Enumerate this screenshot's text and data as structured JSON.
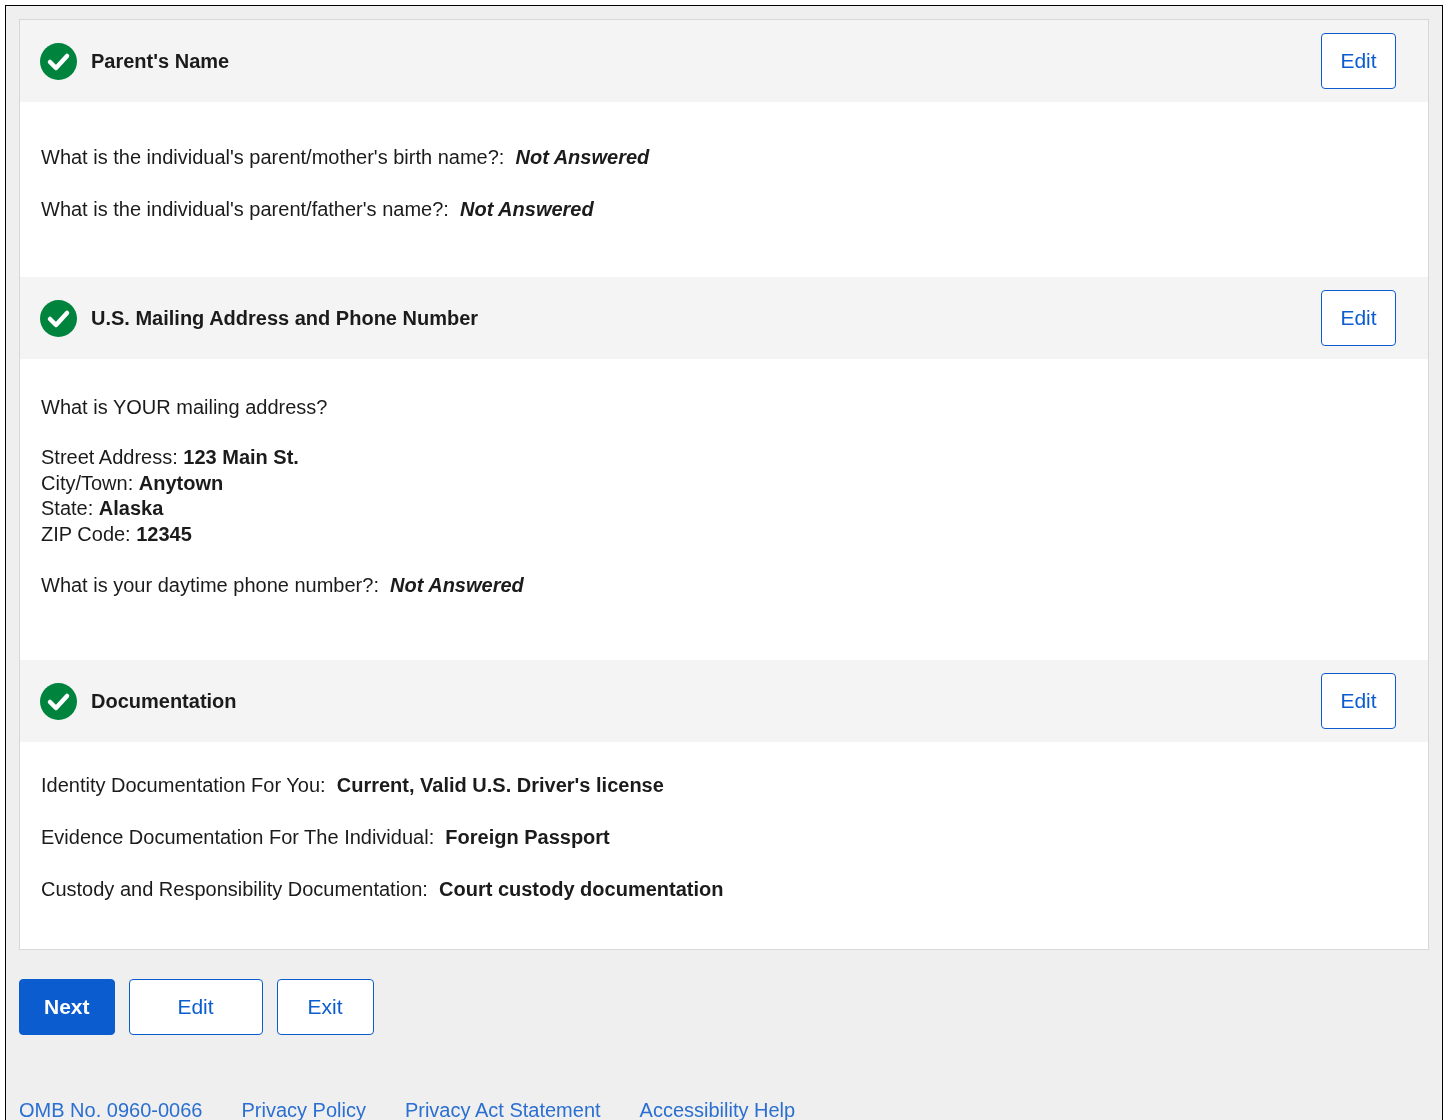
{
  "sections": [
    {
      "title": "Parent's Name",
      "complete": true,
      "edit_label": "Edit",
      "blocks": [
        {
          "kind": "qa",
          "question": "What is the individual's parent/mother's birth name?:",
          "answer": "Not Answered",
          "answered": false
        },
        {
          "kind": "qa",
          "question": "What is the individual's parent/father's name?:",
          "answer": "Not Answered",
          "answered": false
        }
      ]
    },
    {
      "title": "U.S. Mailing Address and Phone Number",
      "complete": true,
      "edit_label": "Edit",
      "blocks": [
        {
          "kind": "heading",
          "text": "What is YOUR mailing address?"
        },
        {
          "kind": "fields",
          "items": [
            {
              "label": "Street Address:",
              "value": "123 Main St."
            },
            {
              "label": "City/Town:",
              "value": "Anytown"
            },
            {
              "label": "State:",
              "value": "Alaska"
            },
            {
              "label": "ZIP Code:",
              "value": "12345"
            }
          ]
        },
        {
          "kind": "qa",
          "question": "What is your daytime phone number?:",
          "answer": "Not Answered",
          "answered": false
        }
      ]
    },
    {
      "title": "Documentation",
      "complete": true,
      "edit_label": "Edit",
      "blocks": [
        {
          "kind": "qa",
          "question": "Identity Documentation For You:",
          "answer": "Current, Valid U.S. Driver's license",
          "answered": true
        },
        {
          "kind": "qa",
          "question": "Evidence Documentation For The Individual:",
          "answer": "Foreign Passport",
          "answered": true
        },
        {
          "kind": "qa",
          "question": "Custody and Responsibility Documentation:",
          "answer": "Court custody documentation",
          "answered": true
        }
      ]
    }
  ],
  "buttons": [
    {
      "label": "Next",
      "primary": true
    },
    {
      "label": "Edit",
      "primary": false
    },
    {
      "label": "Exit",
      "primary": false
    }
  ],
  "footer_links": [
    "OMB No. 0960-0066",
    "Privacy Policy",
    "Privacy Act Statement",
    "Accessibility Help"
  ]
}
